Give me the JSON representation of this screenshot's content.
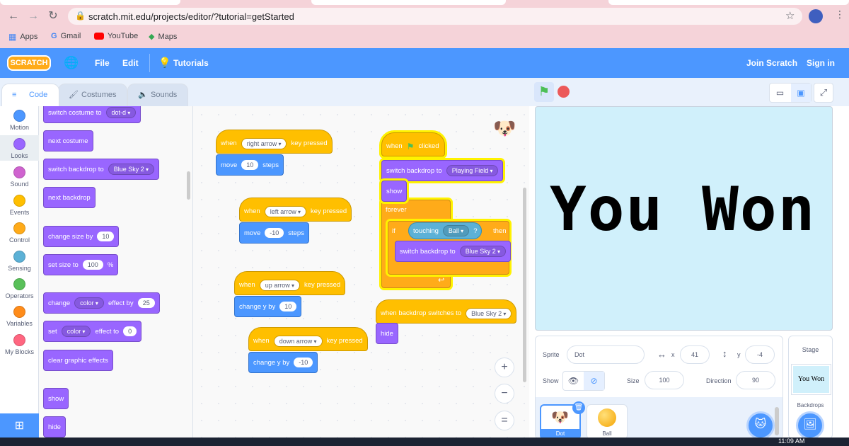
{
  "browser": {
    "url": "scratch.mit.edu/projects/editor/?tutorial=getStarted",
    "bookmarks": [
      "Apps",
      "Gmail",
      "YouTube",
      "Maps"
    ]
  },
  "menu": {
    "logo": "SCRATCH",
    "file": "File",
    "edit": "Edit",
    "tutorials": "Tutorials",
    "join": "Join Scratch",
    "signin": "Sign in"
  },
  "tabs": {
    "code": "Code",
    "costumes": "Costumes",
    "sounds": "Sounds"
  },
  "categories": [
    {
      "label": "Motion",
      "color": "#4c97ff"
    },
    {
      "label": "Looks",
      "color": "#9966ff"
    },
    {
      "label": "Sound",
      "color": "#cf63cf"
    },
    {
      "label": "Events",
      "color": "#ffbf00"
    },
    {
      "label": "Control",
      "color": "#ffab19"
    },
    {
      "label": "Sensing",
      "color": "#5cb1d6"
    },
    {
      "label": "Operators",
      "color": "#59c059"
    },
    {
      "label": "Variables",
      "color": "#ff8c1a"
    },
    {
      "label": "My Blocks",
      "color": "#ff6680"
    }
  ],
  "palette": {
    "switch_costume": "switch costume to",
    "costume_value": "dot-d",
    "next_costume": "next costume",
    "switch_backdrop": "switch backdrop to",
    "backdrop_value": "Blue Sky 2",
    "next_backdrop": "next backdrop",
    "change_size": "change size by",
    "change_size_value": "10",
    "set_size": "set size to",
    "set_size_value": "100",
    "percent": "%",
    "change": "change",
    "color1": "color",
    "effect_by": "effect by",
    "effect_by_value": "25",
    "set": "set",
    "color2": "color",
    "effect_to": "effect to",
    "effect_to_value": "0",
    "clear_effects": "clear graphic effects",
    "show": "show",
    "hide": "hide"
  },
  "scripts": {
    "when": "when",
    "key_pressed": "key pressed",
    "right_arrow": "right arrow",
    "move": "move",
    "move1": "10",
    "steps": "steps",
    "left_arrow": "left arrow",
    "move2": "-10",
    "up_arrow": "up arrow",
    "change_y": "change y by",
    "change_y1": "10",
    "down_arrow": "down arrow",
    "change_y2": "-10",
    "clicked": "clicked",
    "switch_backdrop": "switch backdrop to",
    "playing_field": "Playing Field",
    "show": "show",
    "forever": "forever",
    "if": "if",
    "touching": "touching",
    "ball": "Ball",
    "q": "?",
    "then": "then",
    "blue_sky": "Blue Sky 2",
    "when_backdrop": "when backdrop switches to",
    "hide": "hide"
  },
  "stage_text": "You Won",
  "sprite": {
    "sprite_label": "Sprite",
    "name": "Dot",
    "x_label": "x",
    "x": "41",
    "y_label": "y",
    "y": "-4",
    "show_label": "Show",
    "size_label": "Size",
    "size": "100",
    "direction_label": "Direction",
    "direction": "90",
    "thumb1": "Dot",
    "thumb2": "Ball"
  },
  "stage_panel": {
    "title": "Stage",
    "thumb": "You Won",
    "backdrops": "Backdrops"
  },
  "taskbar": {
    "time": "11:09 AM"
  },
  "colors": {
    "menu": "#4c97ff",
    "stage_bg": "#d0f0fb"
  }
}
